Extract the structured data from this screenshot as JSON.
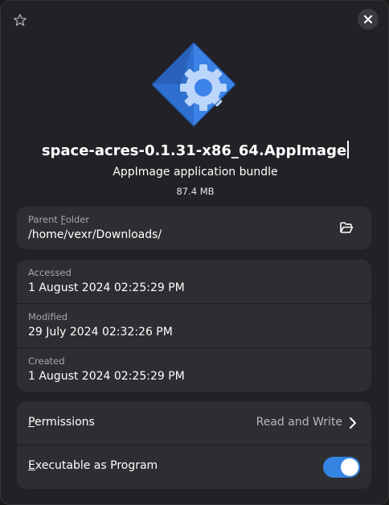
{
  "header": {
    "star_icon": "star-icon",
    "close_icon": "close-icon"
  },
  "file": {
    "name": "space-acres-0.1.31-x86_64.AppImage",
    "type": "AppImage application bundle",
    "size": "87.4 MB",
    "icon": "appimage-icon"
  },
  "parent": {
    "label_pre": "Parent ",
    "label_mnemonic": "F",
    "label_post": "older",
    "path": "/home/vexr/Downloads/",
    "open_icon": "folder-open-icon"
  },
  "dates": [
    {
      "label": "Accessed",
      "value": "1 August 2024 02:25:29 PM"
    },
    {
      "label": "Modified",
      "value": "29 July 2024 02:32:26 PM"
    },
    {
      "label": "Created",
      "value": "1 August 2024 02:25:29 PM"
    }
  ],
  "permissions": {
    "title_mnemonic": "P",
    "title_rest": "ermissions",
    "value": "Read and Write",
    "chevron_icon": "chevron-right-icon"
  },
  "executable": {
    "title_mnemonic": "E",
    "title_rest": "xecutable as Program",
    "enabled": true
  },
  "colors": {
    "accent": "#3584e4",
    "card": "#2e2e32",
    "background": "#222226"
  }
}
